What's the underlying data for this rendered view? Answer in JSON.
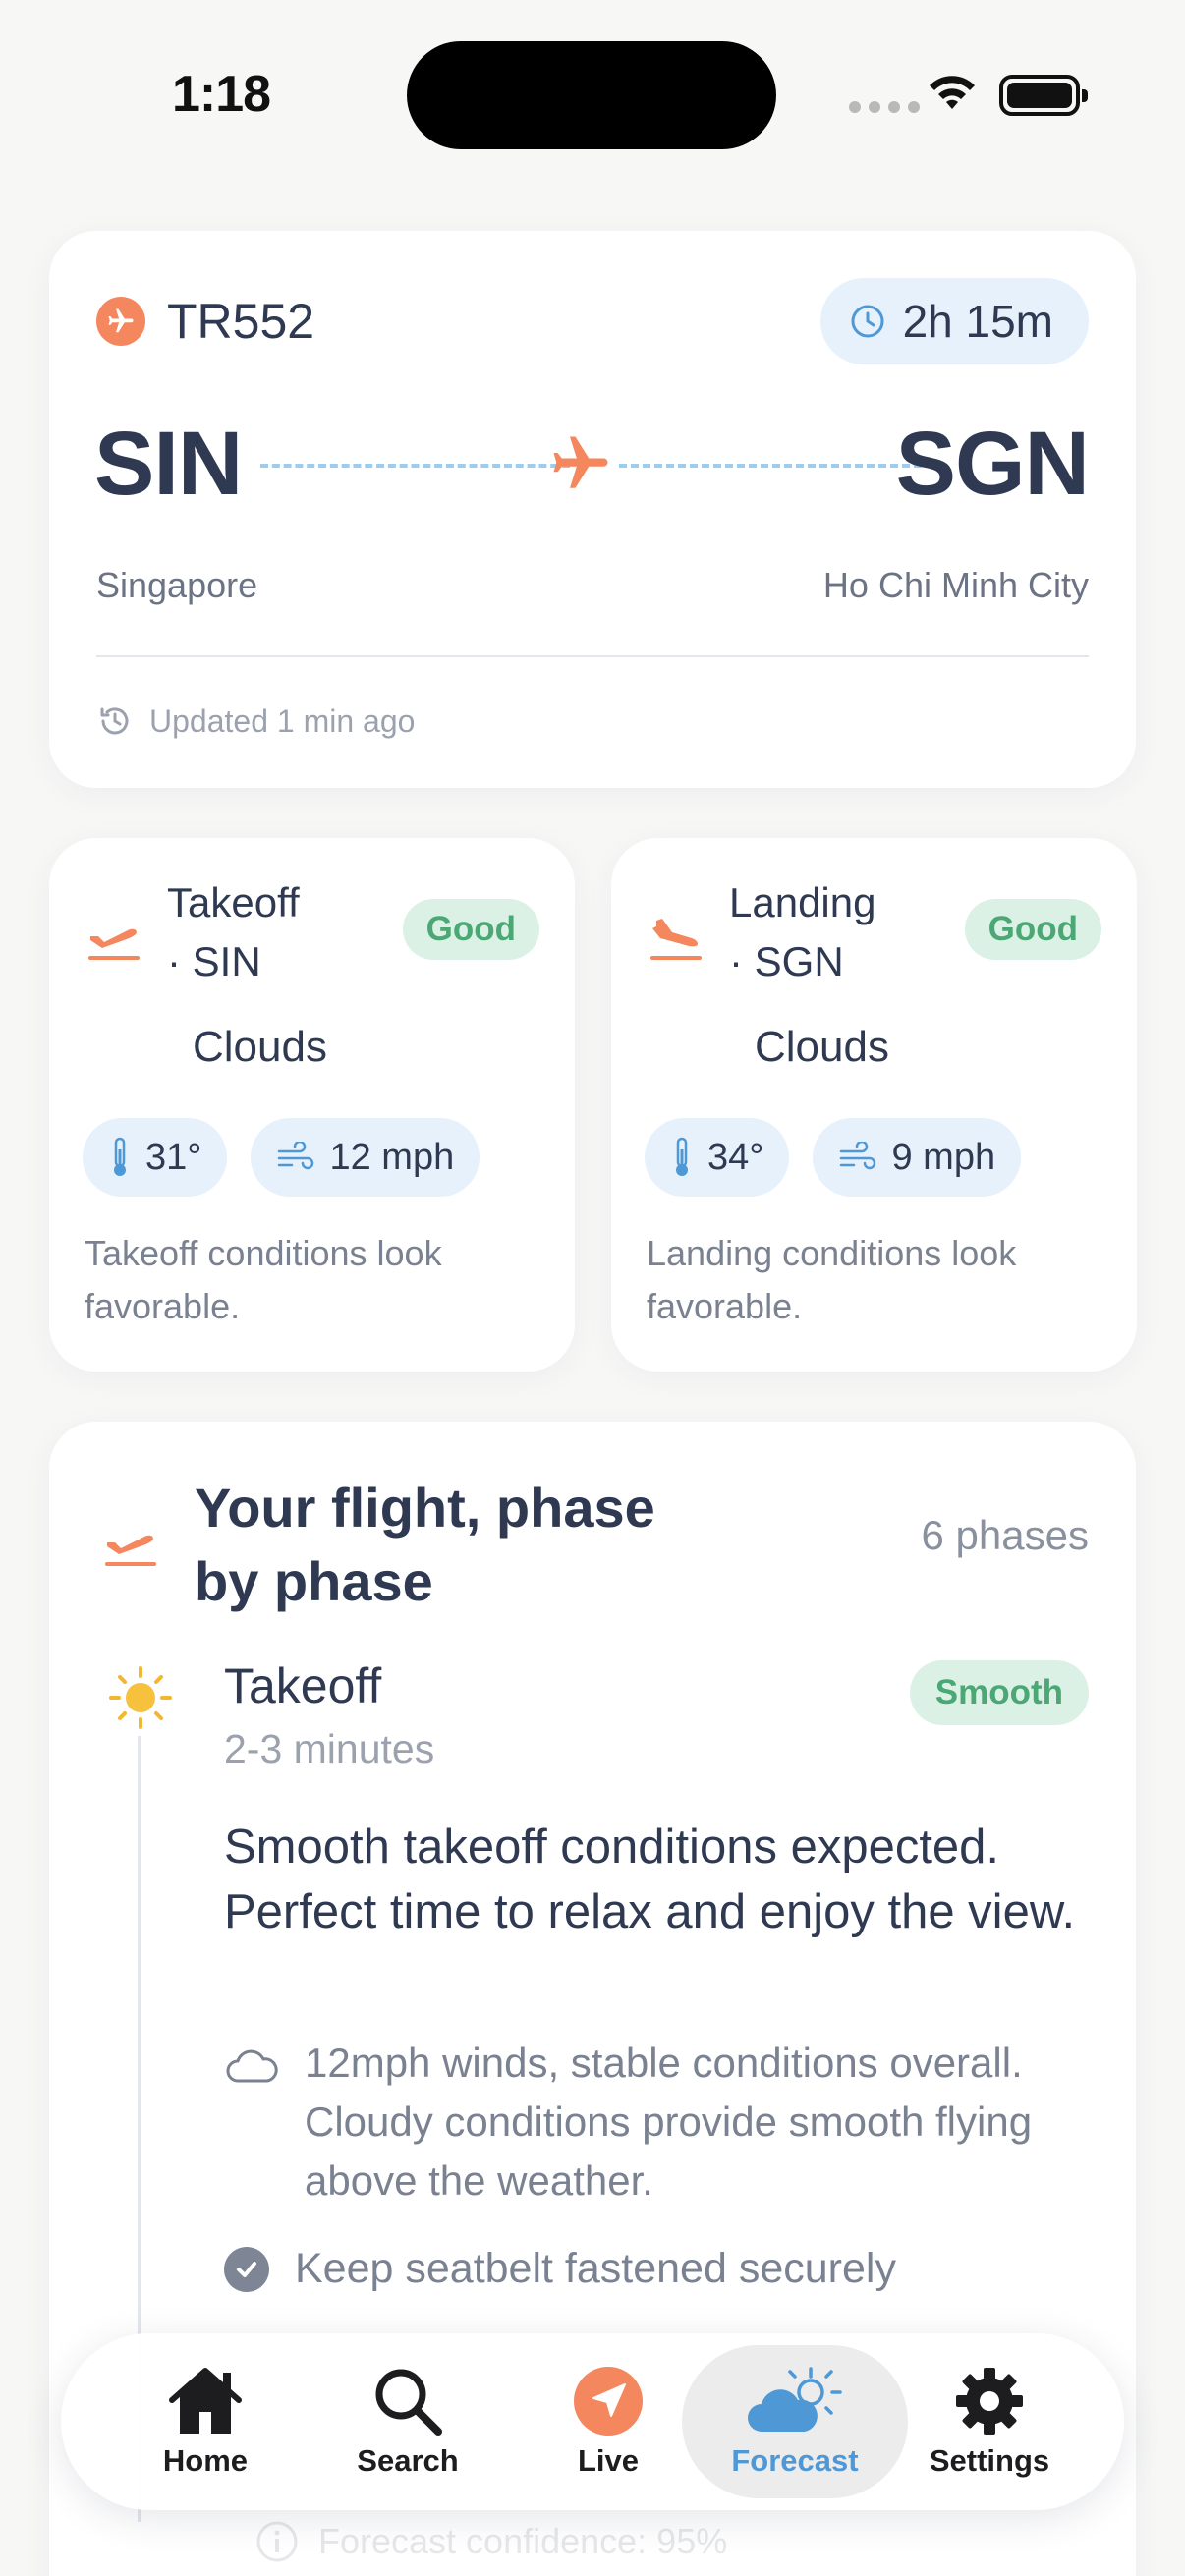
{
  "status_bar": {
    "time": "1:18"
  },
  "flight": {
    "number": "TR552",
    "duration": "2h 15m",
    "origin_code": "SIN",
    "destination_code": "SGN",
    "origin_city": "Singapore",
    "destination_city": "Ho Chi Minh City",
    "updated": "Updated 1 min ago"
  },
  "conditions": [
    {
      "title_line1": "Takeoff",
      "title_line2": "· SIN",
      "rating": "Good",
      "weather": "Clouds",
      "temp": "31°",
      "wind": "12 mph",
      "note": "Takeoff conditions look favorable."
    },
    {
      "title_line1": "Landing",
      "title_line2": "· SGN",
      "rating": "Good",
      "weather": "Clouds",
      "temp": "34°",
      "wind": "9 mph",
      "note": "Landing conditions look favorable."
    }
  ],
  "phases": {
    "title": "Your flight, phase by phase",
    "count": "6 phases",
    "current": {
      "name": "Takeoff",
      "duration": "2-3 minutes",
      "rating": "Smooth",
      "description": "Smooth takeoff conditions expected. Perfect time to relax and enjoy the view.",
      "detail": "12mph winds, stable conditions overall. Cloudy conditions provide smooth flying above the weather.",
      "tip": "Keep seatbelt fastened securely"
    },
    "confidence": "Forecast confidence: 95%"
  },
  "tabs": [
    {
      "label": "Home",
      "icon": "house-icon"
    },
    {
      "label": "Search",
      "icon": "magnifier-icon"
    },
    {
      "label": "Live",
      "icon": "navigation-arrow-icon"
    },
    {
      "label": "Forecast",
      "icon": "cloud-sun-icon",
      "active": true
    },
    {
      "label": "Settings",
      "icon": "gear-icon"
    }
  ],
  "colors": {
    "accent": "#f4875e",
    "primary_text": "#2f3a52",
    "good": "#4ba774",
    "chip_bg": "#e6f1fb",
    "active_tab": "#4f98d6"
  }
}
